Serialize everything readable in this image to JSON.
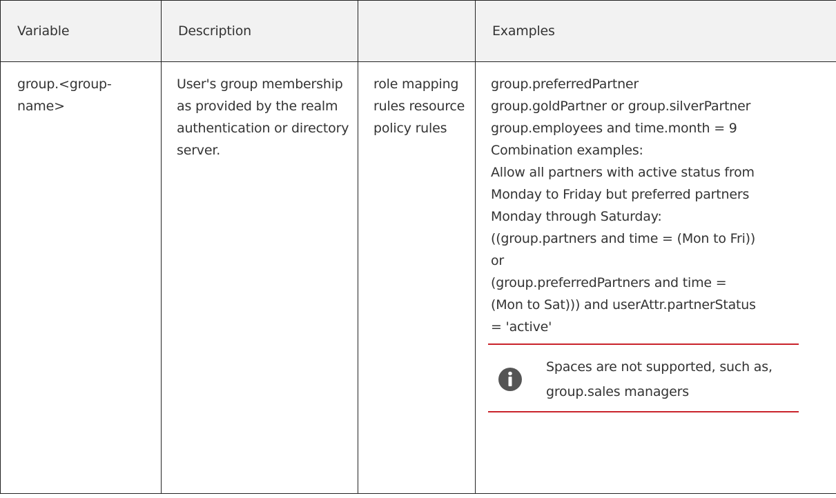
{
  "table": {
    "headers": [
      "Variable",
      "Description",
      "",
      "Examples"
    ],
    "row": {
      "variable": "group.<group-name>",
      "description": "User's group membership as provided by the realm authentication or directory server.",
      "usage": "role mapping rules resource policy rules",
      "examples": [
        "group.preferredPartner",
        "group.goldPartner or group.silverPartner",
        "group.employees and time.month = 9",
        "Combination examples:",
        "Allow all partners with active status from",
        "Monday to Friday but preferred partners",
        "Monday through Saturday:",
        "((group.partners and time = (Mon to Fri))",
        "or",
        "(group.preferredPartners and time =",
        "(Mon to Sat))) and userAttr.partnerStatus",
        "= 'active'"
      ],
      "note": {
        "icon": "info-icon",
        "text": "Spaces are not supported, such as, group.sales managers"
      }
    }
  },
  "colors": {
    "header_bg": "#f2f2f2",
    "border": "#222222",
    "note_rule": "#c9222a",
    "icon": "#555555"
  }
}
